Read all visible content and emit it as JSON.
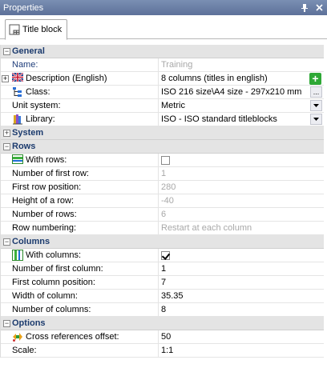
{
  "window": {
    "title": "Properties",
    "pin_glyph": "⩥",
    "close_glyph": "✕"
  },
  "tab": {
    "label": "Title block",
    "icon": "title-block-icon"
  },
  "general": {
    "label": "General",
    "name": {
      "label": "Name:",
      "value": "Training"
    },
    "description": {
      "label": "Description (English)",
      "value": "8 columns (titles in english)",
      "icon": "flag-uk-icon"
    },
    "class": {
      "label": "Class:",
      "value": "ISO 216 size\\A4 size - 297x210 mm",
      "icon": "class-tree-icon",
      "button": "..."
    },
    "unit_system": {
      "label": "Unit system:",
      "value": "Metric"
    },
    "library": {
      "label": "Library:",
      "value": "ISO - ISO standard titleblocks",
      "icon": "library-books-icon"
    }
  },
  "system": {
    "label": "System"
  },
  "rows": {
    "label": "Rows",
    "with_rows": {
      "label": "With rows:",
      "checked": false,
      "icon": "rows-icon"
    },
    "first_row_number": {
      "label": "Number of first row:",
      "value": "1"
    },
    "first_row_position": {
      "label": "First row position:",
      "value": "280"
    },
    "row_height": {
      "label": "Height of a row:",
      "value": "-40"
    },
    "row_count": {
      "label": "Number of rows:",
      "value": "6"
    },
    "row_numbering": {
      "label": "Row numbering:",
      "value": "Restart at each column"
    }
  },
  "columns": {
    "label": "Columns",
    "with_columns": {
      "label": "With columns:",
      "checked": true,
      "icon": "columns-icon"
    },
    "first_column_number": {
      "label": "Number of first column:",
      "value": "1"
    },
    "first_column_position": {
      "label": "First column position:",
      "value": "7"
    },
    "column_width": {
      "label": "Width of column:",
      "value": "35.35"
    },
    "column_count": {
      "label": "Number of columns:",
      "value": "8"
    }
  },
  "options": {
    "label": "Options",
    "cross_ref_offset": {
      "label": "Cross references offset:",
      "value": "50",
      "icon": "cross-ref-icon"
    },
    "scale": {
      "label": "Scale:",
      "value": "1:1"
    }
  },
  "colors": {
    "title_bar": "#6b80a8",
    "category_bg": "#e4e4e4",
    "category_text": "#1c3b6e",
    "disabled_text": "#a8a8a8",
    "add_button": "#2ea836"
  }
}
